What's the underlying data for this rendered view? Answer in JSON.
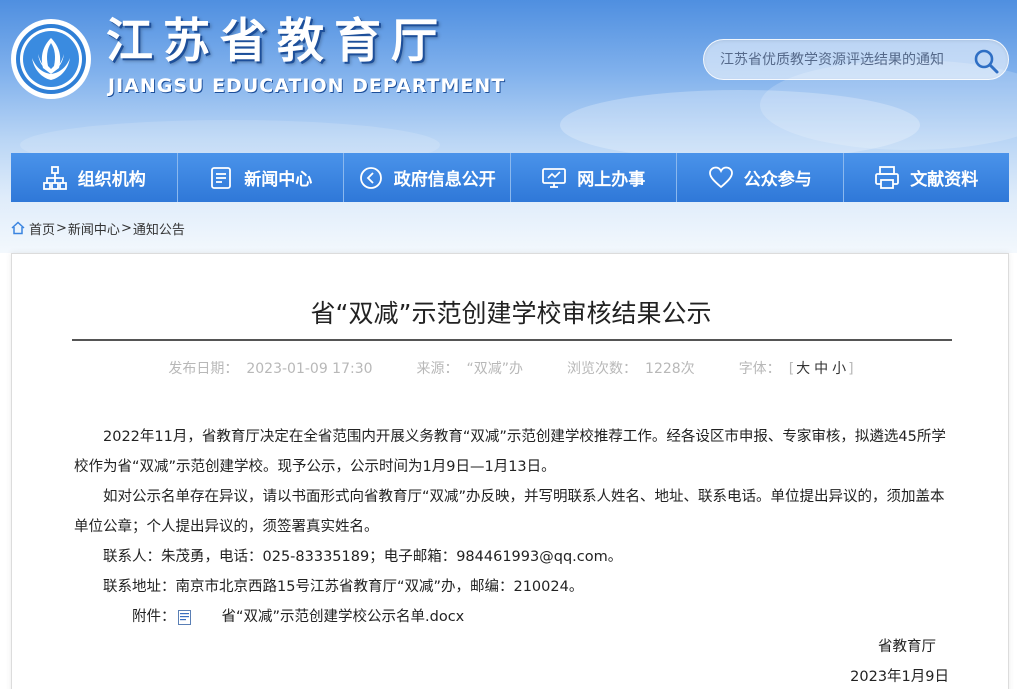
{
  "header": {
    "site_title": "江苏省教育厅",
    "site_subtitle": "JIANGSU EDUCATION DEPARTMENT",
    "search_placeholder": "江苏省优质教学资源评选结果的通知",
    "logo_icon": "jiangsu-education-emblem-icon",
    "search_icon": "search-icon"
  },
  "nav": {
    "items": [
      {
        "label": "组织机构",
        "icon": "org-chart-icon"
      },
      {
        "label": "新闻中心",
        "icon": "news-document-icon"
      },
      {
        "label": "政府信息公开",
        "icon": "play-circle-icon"
      },
      {
        "label": "网上办事",
        "icon": "monitor-icon"
      },
      {
        "label": "公众参与",
        "icon": "heart-icon"
      },
      {
        "label": "文献资料",
        "icon": "printer-icon"
      }
    ]
  },
  "breadcrumb": {
    "home": "首页",
    "sep1": ">",
    "news": "新闻中心",
    "sep2": ">",
    "notice": "通知公告"
  },
  "article": {
    "title": "省“双减”示范创建学校审核结果公示",
    "publish_label": "发布日期：",
    "publish_date": "2023-01-09 17:30",
    "source_label": "来源：",
    "source": "“双减”办",
    "views_label": "浏览次数：",
    "views": "1228次",
    "font_label": "字体：",
    "font_open": "[",
    "font_large": "大",
    "font_medium": "中",
    "font_small": "小",
    "font_close": "]",
    "paragraphs": [
      "2022年11月，省教育厅决定在全省范围内开展义务教育“双减”示范创建学校推荐工作。经各设区市申报、专家审核，拟遴选45所学校作为省“双减”示范创建学校。现予公示，公示时间为1月9日—1月13日。",
      "如对公示名单存在异议，请以书面形式向省教育厅“双减”办反映，并写明联系人姓名、地址、联系电话。单位提出异议的，须加盖本单位公章；个人提出异议的，须签署真实姓名。",
      "联系人：朱茂勇，电话：025-83335189；电子邮箱：984461993@qq.com。",
      "联系地址：南京市北京西路15号江苏省教育厅“双减”办，邮编：210024。"
    ],
    "attachment_label": "附件：",
    "attachment_name": "省“双减”示范创建学校公示名单.docx",
    "attachment_icon": "docx-file-icon",
    "signer": "省教育厅",
    "sign_date": "2023年1月9日"
  },
  "colors": {
    "nav_bg": "#3a84e0",
    "sky_top": "#4f8fe0",
    "text": "#222222",
    "meta": "#b8b8b8"
  }
}
